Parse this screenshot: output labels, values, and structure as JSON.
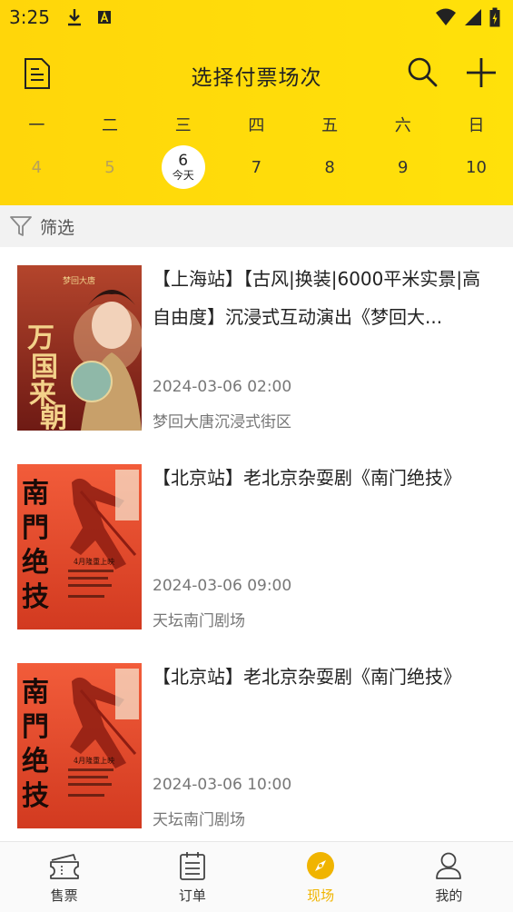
{
  "status_bar": {
    "time": "3:25"
  },
  "header": {
    "title": "选择付票场次"
  },
  "calendar": {
    "weekdays": [
      "一",
      "二",
      "三",
      "四",
      "五",
      "六",
      "日"
    ],
    "dates": [
      "4",
      "5",
      "6",
      "7",
      "8",
      "9",
      "10"
    ],
    "today_label": "今天"
  },
  "filter": {
    "label": "筛选"
  },
  "events": [
    {
      "title": "【上海站】【古风|换装|6000平米实景|高自由度】沉浸式互动演出《梦回大...",
      "time": "2024-03-06 02:00",
      "venue": "梦回大唐沉浸式街区",
      "poster_text": "万国来朝",
      "poster_sub": "梦回大唐"
    },
    {
      "title": "【北京站】老北京杂耍剧《南门绝技》",
      "time": "2024-03-06 09:00",
      "venue": "天坛南门剧场",
      "poster_text": "南門绝技",
      "poster_sub": "4月隆重上映"
    },
    {
      "title": "【北京站】老北京杂耍剧《南门绝技》",
      "time": "2024-03-06 10:00",
      "venue": "天坛南门剧场",
      "poster_text": "南門绝技",
      "poster_sub": "4月隆重上映"
    }
  ],
  "tabs": [
    {
      "label": "售票",
      "icon": "ticket-icon"
    },
    {
      "label": "订单",
      "icon": "order-list-icon"
    },
    {
      "label": "现场",
      "icon": "compass-icon"
    },
    {
      "label": "我的",
      "icon": "user-icon"
    }
  ],
  "colors": {
    "accent": "#ffd60a",
    "active_tab": "#f0b400"
  }
}
